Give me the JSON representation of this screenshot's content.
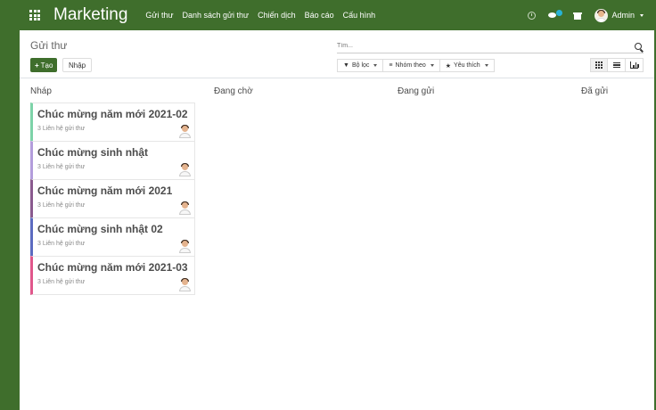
{
  "navbar": {
    "brand": "Marketing",
    "menu": [
      "Gửi thư",
      "Danh sách gửi thư",
      "Chiến dịch",
      "Báo cáo",
      "Cấu hình"
    ],
    "user": "Admin",
    "bg_color": "#3f6e2c"
  },
  "control_panel": {
    "breadcrumb": "Gửi thư",
    "create_label": "Tạo",
    "import_label": "Nhập",
    "search_placeholder": "Tìm...",
    "filters_label": "Bộ lọc",
    "group_by_label": "Nhóm theo",
    "favorites_label": "Yêu thích",
    "views": [
      "kanban-icon",
      "list-icon",
      "graph-icon"
    ]
  },
  "columns": [
    {
      "title": "Nháp",
      "cards": [
        {
          "title": "Chúc mừng năm mới 2021-02",
          "subtitle": "3 Liên hệ gửi thư",
          "color": "#7dd3a8"
        },
        {
          "title": "Chúc mừng sinh nhật",
          "subtitle": "3 Liên hệ gửi thư",
          "color": "#b39ddb"
        },
        {
          "title": "Chúc mừng năm mới 2021",
          "subtitle": "3 Liên hệ gửi thư",
          "color": "#8a5a8e"
        },
        {
          "title": "Chúc mừng sinh nhật 02",
          "subtitle": "3 Liên hệ gửi thư",
          "color": "#5c6bc0"
        },
        {
          "title": "Chúc mừng năm mới 2021-03",
          "subtitle": "3 Liên hệ gửi thư",
          "color": "#e0578b"
        }
      ]
    },
    {
      "title": "Đang chờ",
      "cards": []
    },
    {
      "title": "Đang gửi",
      "cards": []
    },
    {
      "title": "Đã gửi",
      "cards": []
    }
  ]
}
